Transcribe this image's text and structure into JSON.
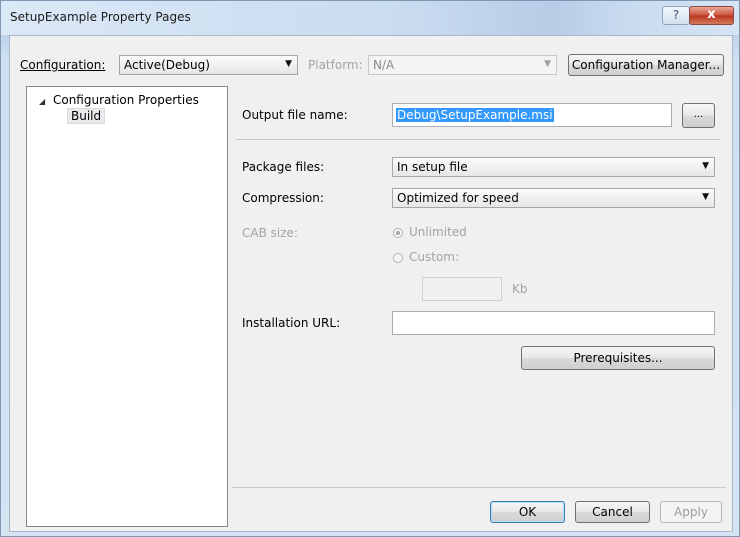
{
  "window": {
    "title": "SetupExample Property Pages",
    "help_glyph": "?",
    "close_glyph": "x"
  },
  "config_bar": {
    "configuration_label": "Configuration:",
    "configuration_value": "Active(Debug)",
    "platform_label": "Platform:",
    "platform_value": "N/A",
    "config_manager_label": "Configuration Manager..."
  },
  "tree": {
    "expander_glyph": "◢",
    "root_label": "Configuration Properties",
    "child_label": "Build"
  },
  "form": {
    "output_label": "Output file name:",
    "output_value": "Debug\\SetupExample.msi",
    "browse_label": "...",
    "package_label": "Package files:",
    "package_value": "In setup file",
    "compression_label": "Compression:",
    "compression_value": "Optimized for speed",
    "cab_label": "CAB size:",
    "unlimited_label": "Unlimited",
    "custom_label": "Custom:",
    "custom_value": "",
    "kb_label": "Kb",
    "install_url_label": "Installation URL:",
    "install_url_value": "",
    "prereq_label": "Prerequisites..."
  },
  "footer": {
    "ok_label": "OK",
    "cancel_label": "Cancel",
    "apply_label": "Apply"
  },
  "icons": {
    "dropdown": "▼",
    "radio_selected": "unlimited"
  },
  "colors": {
    "selection": "#3399ff",
    "close_button": "#c9503a",
    "title_bar": "#c9dbef"
  }
}
